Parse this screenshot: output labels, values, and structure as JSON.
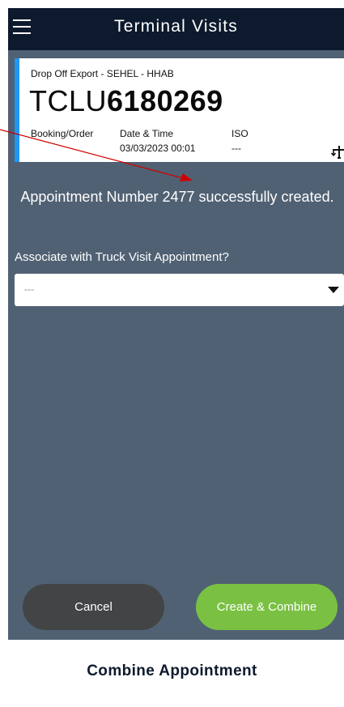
{
  "app": {
    "title": "Terminal Visits"
  },
  "card": {
    "type_line": "Drop Off Export - SEHEL - HHAB",
    "container_prefix": "TCLU",
    "container_digits": "6180269",
    "fields": {
      "booking_label": "Booking/Order",
      "datetime_label": "Date & Time",
      "datetime_value": "03/03/2023 00:01",
      "iso_label": "ISO",
      "iso_value": "---"
    },
    "accent_color": "#2196f3"
  },
  "message": "Appointment Number 2477 successfully created.",
  "associate": {
    "label": "Associate with Truck Visit Appointment?",
    "selected": "---"
  },
  "buttons": {
    "cancel": "Cancel",
    "create_combine": "Create & Combine"
  },
  "caption": "Combine Appointment",
  "colors": {
    "topbar": "#0d1a2d",
    "background": "#506173",
    "cancel": "#424446",
    "create": "#7ac143",
    "annotation_arrow": "#d00000"
  },
  "icons": {
    "menu": "hamburger-icon",
    "crane": "crane-icon",
    "dropdown": "caret-down-icon"
  }
}
